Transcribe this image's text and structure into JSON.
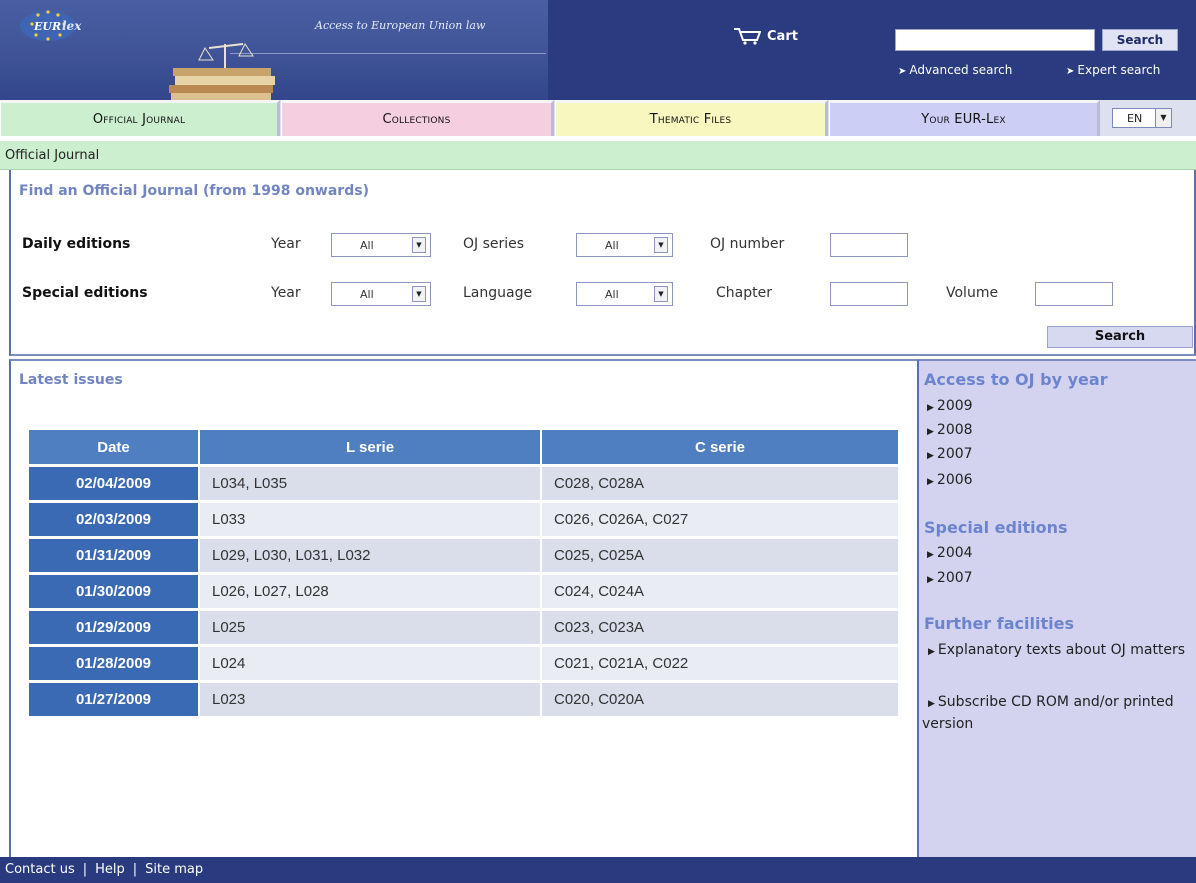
{
  "header": {
    "tagline": "Access to European Union law",
    "cart_label": "Cart",
    "search_button": "Search",
    "advanced_search": "Advanced search",
    "expert_search": "Expert search"
  },
  "tabs": {
    "official_journal": "Official Journal",
    "collections": "Collections",
    "thematic_files": "Thematic Files",
    "your_eurlex": "Your EUR-Lex",
    "language": "EN"
  },
  "breadcrumb": "Official Journal",
  "find": {
    "title": "Find an Official Journal (from 1998 onwards)",
    "daily_label": "Daily editions",
    "special_label": "Special editions",
    "year_label": "Year",
    "oj_series_label": "OJ series",
    "oj_number_label": "OJ number",
    "language_label": "Language",
    "chapter_label": "Chapter",
    "volume_label": "Volume",
    "select_value": "All",
    "search_button": "Search"
  },
  "latest": {
    "title": "Latest issues",
    "columns": [
      "Date",
      "L serie",
      "C serie"
    ],
    "rows": [
      {
        "date": "02/04/2009",
        "l": "L034, L035",
        "c": "C028, C028A"
      },
      {
        "date": "02/03/2009",
        "l": "L033",
        "c": "C026, C026A, C027"
      },
      {
        "date": "01/31/2009",
        "l": "L029, L030, L031, L032",
        "c": "C025, C025A"
      },
      {
        "date": "01/30/2009",
        "l": "L026, L027, L028",
        "c": "C024, C024A"
      },
      {
        "date": "01/29/2009",
        "l": "L025",
        "c": "C023, C023A"
      },
      {
        "date": "01/28/2009",
        "l": "L024",
        "c": "C021, C021A, C022"
      },
      {
        "date": "01/27/2009",
        "l": "L023",
        "c": "C020, C020A"
      }
    ]
  },
  "sidebar": {
    "access_title": "Access to OJ by year",
    "years": [
      "2009",
      "2008",
      "2007",
      "2006"
    ],
    "special_title": "Special editions",
    "special_years": [
      "2004",
      "2007"
    ],
    "further_title": "Further facilities",
    "explanatory": "Explanatory texts about OJ matters",
    "subscribe": "Subscribe CD ROM and/or printed version"
  },
  "footer": {
    "contact": "Contact us",
    "help": "Help",
    "sitemap": "Site map"
  },
  "colors": {
    "header_bg": "#2a3b80",
    "accent_blue": "#3b6ab4",
    "oj_green": "#ccefcf",
    "collections_pink": "#f5cfe0",
    "thematic_yellow": "#f8f7bf",
    "your_lilac": "#cdcef6"
  }
}
